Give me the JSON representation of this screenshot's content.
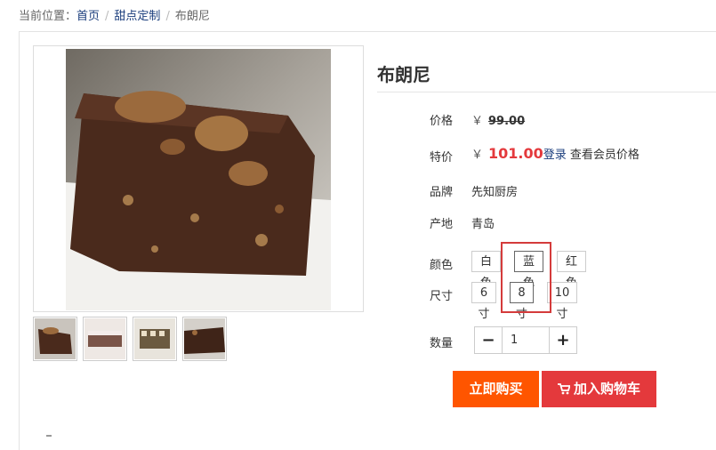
{
  "breadcrumb": {
    "prefix": "当前位置：",
    "home": "首页",
    "category": "甜点定制",
    "current": "布朗尼",
    "separator": "/"
  },
  "product": {
    "title": "布朗尼",
    "price_label": "价格",
    "price_currency": "￥",
    "price_value": "99.00",
    "special_label": "特价",
    "special_currency": "￥",
    "special_value": "101.00",
    "login_link": "登录",
    "member_text": " 查看会员价格",
    "brand_label": "品牌",
    "brand_value": "先知厨房",
    "origin_label": "产地",
    "origin_value": "青岛",
    "color_label": "颜色",
    "colors": [
      "白色",
      "蓝色",
      "红色"
    ],
    "color_selected": "蓝色",
    "size_label": "尺寸",
    "sizes": [
      "6寸",
      "8寸",
      "10寸"
    ],
    "size_selected": "8寸",
    "qty_label": "数量",
    "qty_value": "1",
    "qty_minus": "−",
    "qty_plus": "+"
  },
  "gallery": {
    "main_image": "brownie-photo",
    "thumbnails": [
      "brownie-thumb-1",
      "cake-thumb-2",
      "cake-thumb-3",
      "brownie-thumb-4"
    ]
  },
  "actions": {
    "buy_label": "立即购买",
    "cart_label": "加入购物车",
    "buy_color": "#ff5500",
    "cart_color": "#e4393c"
  },
  "accent": {
    "link": "#1a3d7c",
    "price": "#e4393c",
    "highlight": "#d43b3b"
  }
}
